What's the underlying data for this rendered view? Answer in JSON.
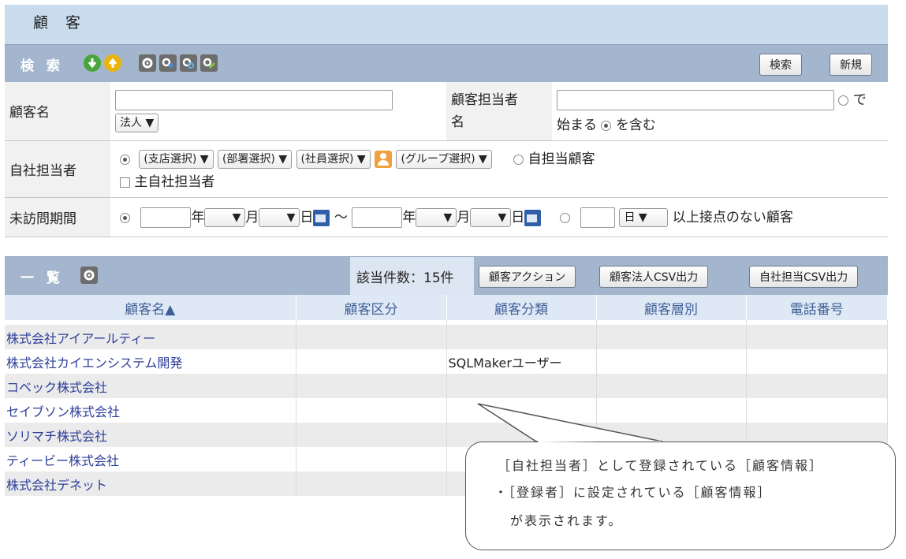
{
  "page": {
    "title": "顧 客"
  },
  "search": {
    "title": "検 索",
    "search_button": "検索",
    "new_button": "新規"
  },
  "form": {
    "customer_name_label": "顧客名",
    "corp_select": "法人 ▼",
    "rep_label_line1": "顧客担当者",
    "rep_label_line2": "名",
    "match_de": "で",
    "match_hajimaru": "始まる",
    "match_fukumu": "を含む",
    "own_rep_label": "自社担当者",
    "branch_select": "(支店選択) ▼",
    "dept_select": "(部署選択) ▼",
    "employee_select": "(社員選択) ▼",
    "group_select": "(グループ選択) ▼",
    "self_customers": "自担当顧客",
    "main_rep": "主自社担当者",
    "unvisited_label": "未訪問期間",
    "nen": "年",
    "tsuki": "月",
    "hi": "日",
    "tilde": "～",
    "day_select": "日",
    "no_contact": "以上接点のない顧客"
  },
  "list": {
    "title": "一 覧",
    "count_text": "該当件数：15件",
    "action_button": "顧客アクション",
    "corp_csv_button": "顧客法人CSV出力",
    "rep_csv_button": "自社担当CSV出力",
    "columns": [
      "顧客名▲",
      "顧客区分",
      "顧客分類",
      "顧客層別",
      "電話番号"
    ],
    "rows": [
      {
        "name": "株式会社アイアールティー",
        "category": ""
      },
      {
        "name": "株式会社カイエンシステム開発",
        "category": "SQLMakerユーザー"
      },
      {
        "name": "コベック株式会社",
        "category": ""
      },
      {
        "name": "セイブソン株式会社",
        "category": ""
      },
      {
        "name": "ソリマチ株式会社",
        "category": ""
      },
      {
        "name": "ティービー株式会社",
        "category": ""
      },
      {
        "name": "株式会社デネット",
        "category": ""
      }
    ]
  },
  "callout": {
    "line1": "［自社担当者］として登録されている［顧客情報］",
    "line2": "・［登録者］に設定されている［顧客情報］",
    "line3": "が表示されます。"
  },
  "colors": {
    "header_bg": "#c9dcee",
    "bar_bg": "#a4b6cd",
    "link": "#2c3e99"
  }
}
